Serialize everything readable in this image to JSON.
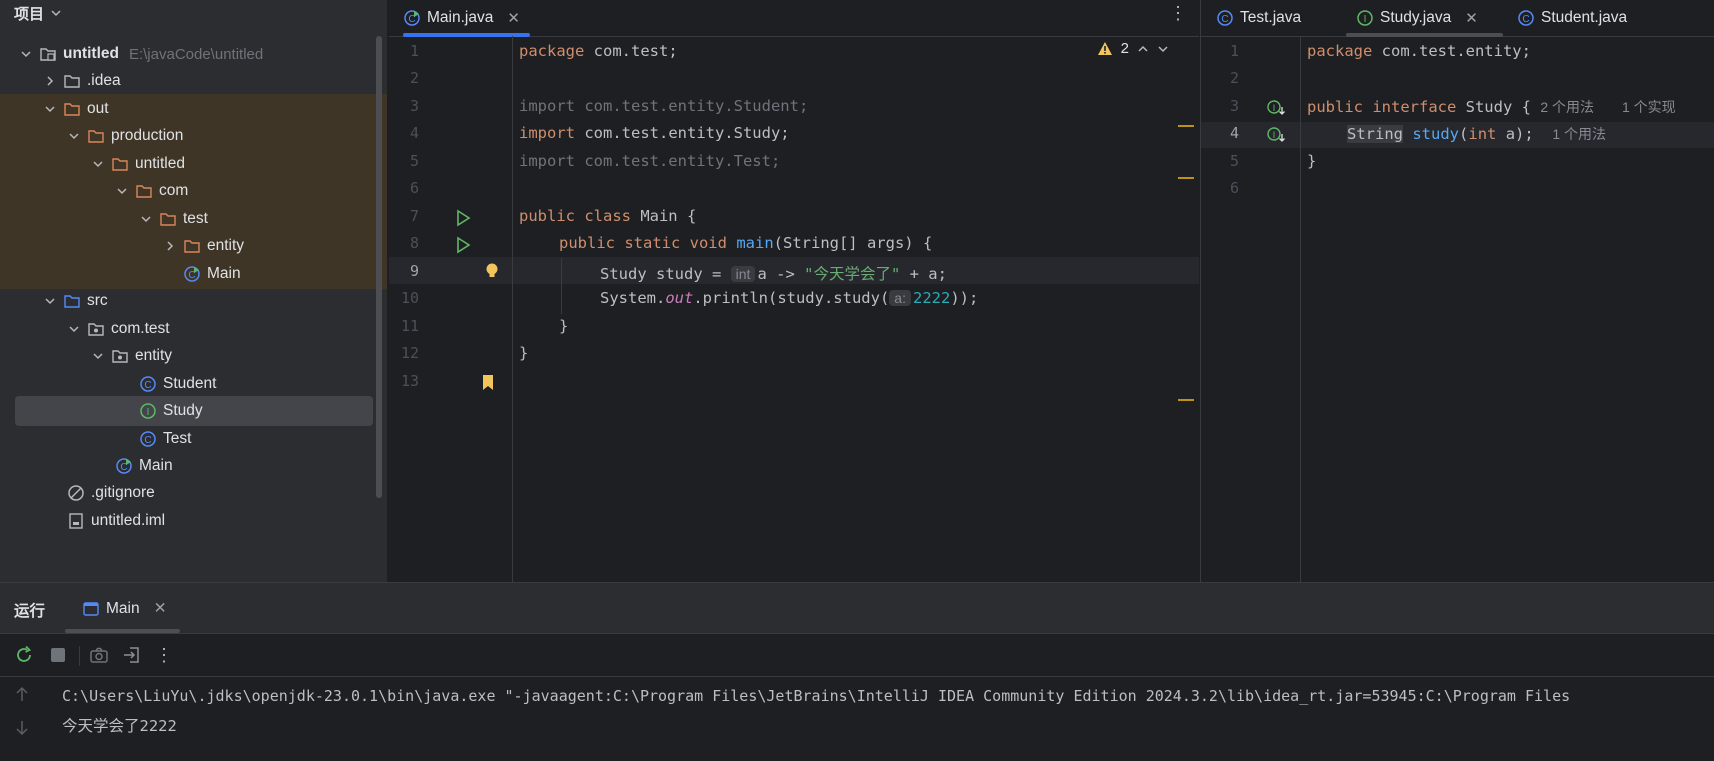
{
  "project_panel": {
    "title": "项目",
    "root_path": "E:\\javaCode\\untitled",
    "tree": [
      {
        "label": "untitled"
      },
      {
        "label": ".idea"
      },
      {
        "label": "out"
      },
      {
        "label": "production"
      },
      {
        "label": "untitled"
      },
      {
        "label": "com"
      },
      {
        "label": "test"
      },
      {
        "label": "entity"
      },
      {
        "label": "Main"
      },
      {
        "label": "src"
      },
      {
        "label": "com.test"
      },
      {
        "label": "entity"
      },
      {
        "label": "Student"
      },
      {
        "label": "Study"
      },
      {
        "label": "Test"
      },
      {
        "label": "Main"
      },
      {
        "label": ".gitignore"
      },
      {
        "label": "untitled.iml"
      }
    ]
  },
  "editor_left": {
    "tab_label": "Main.java",
    "warning_count": "2",
    "line_numbers": [
      "1",
      "2",
      "3",
      "4",
      "5",
      "6",
      "7",
      "8",
      "9",
      "10",
      "11",
      "12",
      "13"
    ],
    "code": {
      "l1_kw": "package",
      "l1_rest": " com.test;",
      "l3": "import com.test.entity.Student;",
      "l4_kw": "import",
      "l4_rest": " com.test.entity.Study;",
      "l5": "import com.test.entity.Test;",
      "l7_kw": "public class",
      "l7_rest": " Main {",
      "l8_kw": "public static void",
      "l8_fn": "main",
      "l8_rest": "(String[] args) {",
      "l9_a": "Study study = ",
      "l9_hint": "int",
      "l9_b": "a -> ",
      "l9_str": "\"今天学会了\"",
      "l9_c": " + a;",
      "l10_a": "System.",
      "l10_out": "out",
      "l10_b": ".println(study.study(",
      "l10_hint": "a:",
      "l10_num": "2222",
      "l10_c": "));",
      "l11": "}",
      "l12": "}"
    }
  },
  "editor_right": {
    "tabs": [
      "Test.java",
      "Study.java",
      "Student.java"
    ],
    "line_numbers": [
      "1",
      "2",
      "3",
      "4",
      "5",
      "6"
    ],
    "code": {
      "l1_kw": "package",
      "l1_rest": " com.test.entity;",
      "l3_kw": "public interface",
      "l3_rest": " Study { ",
      "l3_usage1": "2 个用法",
      "l3_usage2": "1 个实现",
      "l4_type": "String",
      "l4_fn": "study",
      "l4_a": "(",
      "l4_kw": "int",
      "l4_b": " a);",
      "l4_usage": "1 个用法",
      "l5": "}"
    }
  },
  "run_panel": {
    "title": "运行",
    "tab_label": "Main",
    "console": [
      "C:\\Users\\LiuYu\\.jdks\\openjdk-23.0.1\\bin\\java.exe \"-javaagent:C:\\Program Files\\JetBrains\\IntelliJ IDEA Community Edition 2024.3.2\\lib\\idea_rt.jar=53945:C:\\Program Files",
      "今天学会了2222"
    ]
  },
  "colors": {
    "background": "#1e1f22",
    "panel": "#2b2d30",
    "accent": "#3574f0",
    "keyword": "#cf8e6d",
    "string": "#6aab73",
    "function": "#56a8f5",
    "number": "#2aacb8",
    "excluded_highlight": "#3f3526"
  }
}
